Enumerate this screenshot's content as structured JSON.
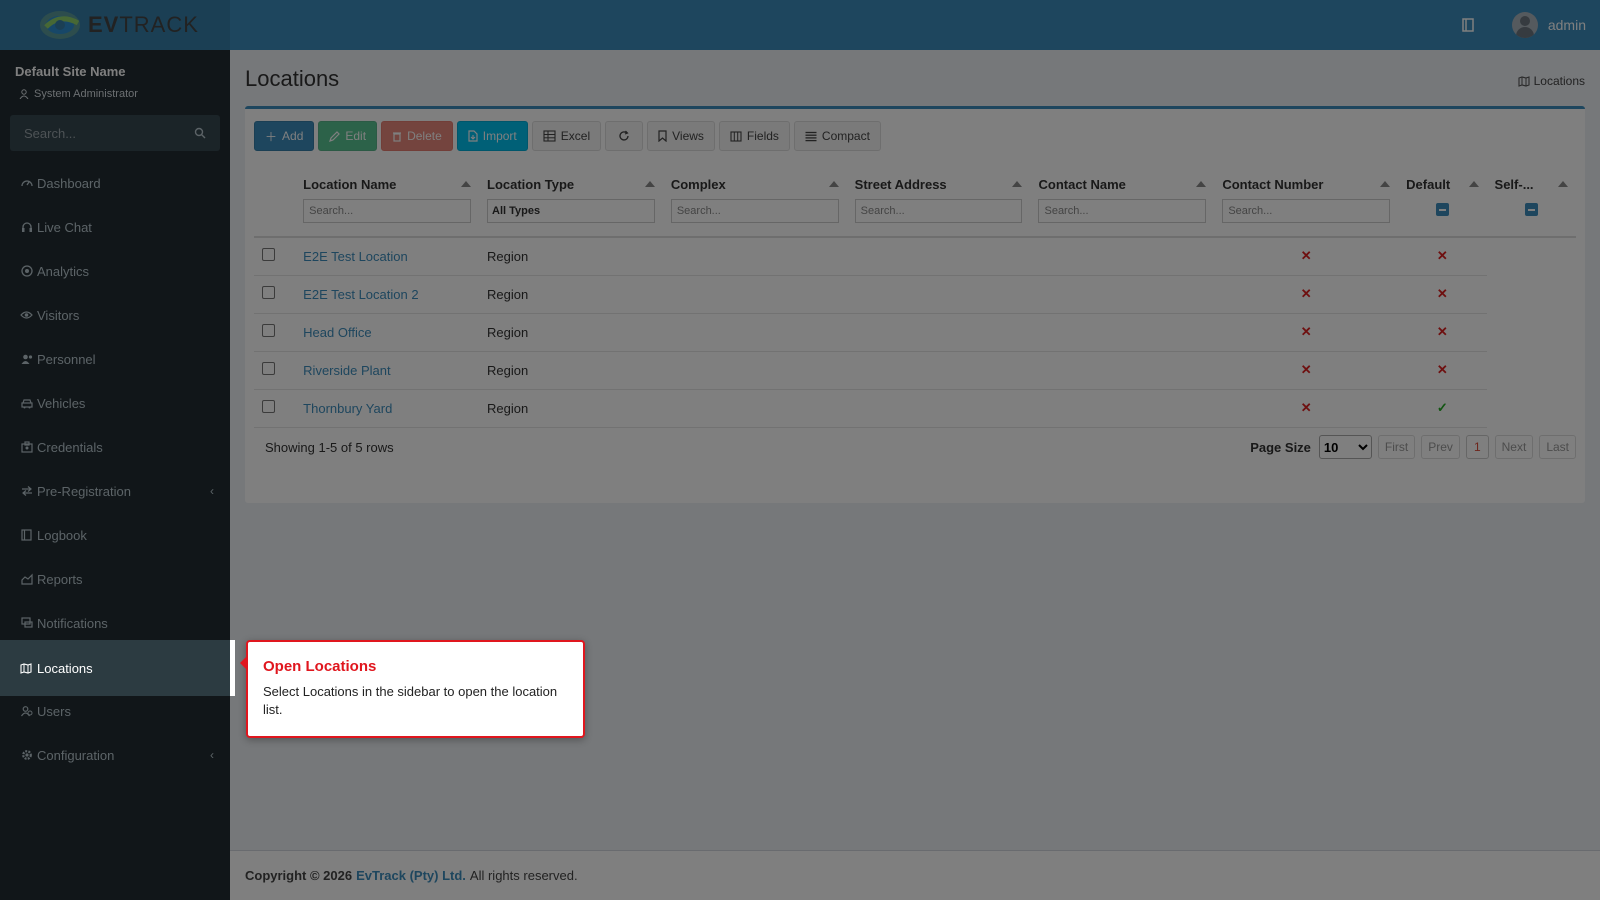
{
  "app": {
    "logo_text_bold": "EV",
    "logo_text_rest": "TRACK"
  },
  "header": {
    "user_name": "admin",
    "icons": [
      "book-icon",
      "user-avatar"
    ]
  },
  "sidebar": {
    "site_name": "Default Site Name",
    "role": "System Administrator",
    "search_placeholder": "Search...",
    "items": [
      {
        "label": "Dashboard",
        "icon": "dashboard-icon"
      },
      {
        "label": "Live Chat",
        "icon": "headset-icon"
      },
      {
        "label": "Analytics",
        "icon": "analytics-icon"
      },
      {
        "label": "Visitors",
        "icon": "eye-icon"
      },
      {
        "label": "Personnel",
        "icon": "personnel-icon"
      },
      {
        "label": "Vehicles",
        "icon": "car-icon"
      },
      {
        "label": "Credentials",
        "icon": "id-card-icon"
      },
      {
        "label": "Pre-Registration",
        "icon": "arrows-icon",
        "expandable": true
      },
      {
        "label": "Logbook",
        "icon": "book-icon"
      },
      {
        "label": "Reports",
        "icon": "chart-icon"
      },
      {
        "label": "Notifications",
        "icon": "chat-icon"
      },
      {
        "label": "Locations",
        "icon": "map-icon",
        "active": true
      },
      {
        "label": "Users",
        "icon": "users-icon"
      },
      {
        "label": "Configuration",
        "icon": "gear-icon",
        "expandable": true
      }
    ]
  },
  "main": {
    "title": "Locations",
    "breadcrumb": "Locations",
    "toolbar": {
      "add": "Add",
      "edit": "Edit",
      "delete": "Delete",
      "import": "Import",
      "excel": "Excel",
      "views": "Views",
      "fields": "Fields",
      "compact": "Compact"
    },
    "columns": [
      {
        "label": "Location Name",
        "filter": "Search..."
      },
      {
        "label": "Location Type",
        "filter_value": "All Types"
      },
      {
        "label": "Complex",
        "filter": "Search..."
      },
      {
        "label": "Street Address",
        "filter": "Search..."
      },
      {
        "label": "Contact Name",
        "filter": "Search..."
      },
      {
        "label": "Contact Number",
        "filter": "Search..."
      },
      {
        "label": "Default"
      },
      {
        "label": "Self-..."
      }
    ],
    "rows": [
      {
        "name": "E2E Test Location",
        "type": "Region",
        "default": "✕",
        "self": "✕"
      },
      {
        "name": "E2E Test Location 2",
        "type": "Region",
        "default": "✕",
        "self": "✕"
      },
      {
        "name": "Head Office",
        "type": "Region",
        "default": "✕",
        "self": "✕"
      },
      {
        "name": "Riverside Plant",
        "type": "Region",
        "default": "✕",
        "self": "✕"
      },
      {
        "name": "Thornbury Yard",
        "type": "Region",
        "default": "✕",
        "self": "✓"
      }
    ],
    "showing": "Showing 1-5 of 5 rows",
    "pager": {
      "page_size_label": "Page Size",
      "page_size": "10",
      "first": "First",
      "prev": "Prev",
      "current": "1",
      "next": "Next",
      "last": "Last"
    }
  },
  "footer": {
    "copyright": "Copyright © 2026",
    "company": "EvTrack (Pty) Ltd.",
    "rights": "All rights reserved."
  },
  "tooltip": {
    "title": "Open Locations",
    "body": "Select Locations in the sidebar to open the location list."
  },
  "colors": {
    "brand": "#3c8dbc",
    "sidebar": "#222d32",
    "tooltip_accent": "#e0161e"
  }
}
